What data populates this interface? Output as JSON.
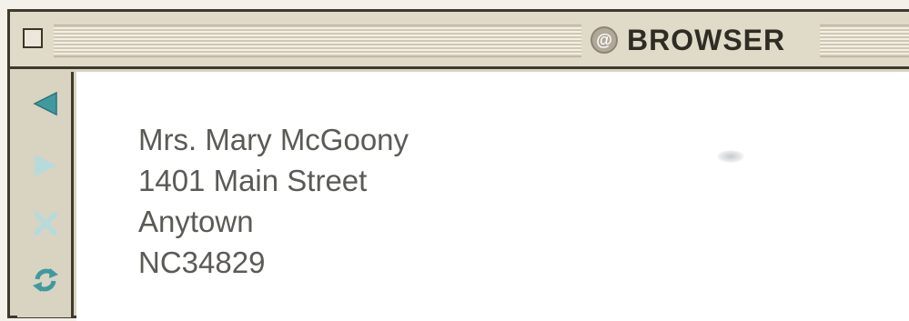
{
  "window": {
    "title": "BROWSER",
    "title_icon": "at-sign-icon"
  },
  "toolbar": {
    "buttons": [
      {
        "name": "back",
        "icon": "back-arrow-icon",
        "enabled": true
      },
      {
        "name": "forward",
        "icon": "forward-arrow-icon",
        "enabled": false
      },
      {
        "name": "stop",
        "icon": "stop-x-icon",
        "enabled": false
      },
      {
        "name": "reload",
        "icon": "reload-icon",
        "enabled": true
      }
    ],
    "active_color": "#3f9aa0",
    "disabled_color": "#b9dadb"
  },
  "content": {
    "address_lines": [
      "Mrs. Mary McGoony",
      "1401 Main Street",
      "Anytown",
      "NC34829"
    ]
  }
}
